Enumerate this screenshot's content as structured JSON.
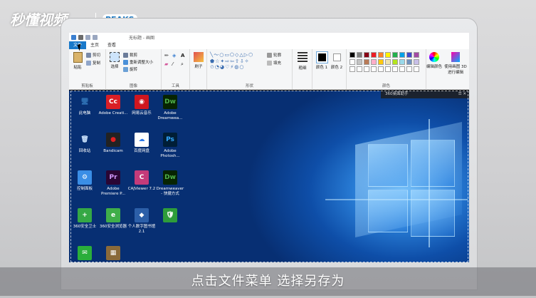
{
  "watermark": {
    "brand": "秒懂视频",
    "partner": "PEAKS"
  },
  "window": {
    "title": "无标题 - 画图"
  },
  "tabs": [
    "文件",
    "主页",
    "查看"
  ],
  "ribbon": {
    "clipboard": {
      "label": "剪贴板",
      "paste": "粘贴",
      "cut": "剪切",
      "copy": "复制"
    },
    "image": {
      "label": "图像",
      "select": "选择",
      "crop": "裁剪",
      "resize": "重新调整大小",
      "rotate": "旋转"
    },
    "tools": {
      "label": "工具"
    },
    "shapes": {
      "label": "形状",
      "brush": "刷子",
      "outline": "轮廓",
      "fill": "填充"
    },
    "size": {
      "label": "粗细"
    },
    "colors": {
      "label": "颜色",
      "color1": "颜色 1",
      "color2": "颜色 2",
      "edit": "编辑颜色",
      "paint3d": "使用画图 3D 进行编辑"
    }
  },
  "palette": [
    "#000000",
    "#7f7f7f",
    "#880015",
    "#ed1c24",
    "#ff7f27",
    "#fff200",
    "#22b14c",
    "#00a2e8",
    "#3f48cc",
    "#a349a4",
    "#ffffff",
    "#c3c3c3",
    "#b97a57",
    "#ffaec9",
    "#ffc90e",
    "#efe4b0",
    "#b5e61d",
    "#99d9ea",
    "#7092be",
    "#c8bfe7"
  ],
  "desktop": {
    "helper": {
      "title": "360桌面助手",
      "controls": "☰ ✕"
    },
    "icons": [
      {
        "name": "此电脑",
        "glyph": "🖥",
        "color": "#2b6cb0",
        "bg": "transparent"
      },
      {
        "name": "Adobe Creati...",
        "glyph": "Cc",
        "color": "#fff",
        "bg": "#da1f26"
      },
      {
        "name": "网易云音乐",
        "glyph": "◉",
        "color": "#fff",
        "bg": "#d0161f"
      },
      {
        "name": "Adobe Dreamwea...",
        "glyph": "Dw",
        "color": "#4fb14a",
        "bg": "#072401"
      },
      {
        "name": "回收站",
        "glyph": "🗑",
        "color": "#cfe6ff",
        "bg": "transparent"
      },
      {
        "name": "Bandicam",
        "glyph": "●",
        "color": "#e12020",
        "bg": "#222"
      },
      {
        "name": "百度网盘",
        "glyph": "☁",
        "color": "#2e7bea",
        "bg": "#fff"
      },
      {
        "name": "Adobe Photosh...",
        "glyph": "Ps",
        "color": "#31a8ff",
        "bg": "#001e36"
      },
      {
        "name": "控制面板",
        "glyph": "⚙",
        "color": "#fff",
        "bg": "#3a8ee6"
      },
      {
        "name": "Adobe Premiere P...",
        "glyph": "Pr",
        "color": "#d49bff",
        "bg": "#2a0634"
      },
      {
        "name": "CAJViewer 7.2",
        "glyph": "C",
        "color": "#fff",
        "bg": "#c43b7a"
      },
      {
        "name": "Dreamweaver - 快捷方式",
        "glyph": "Dw",
        "color": "#4fb14a",
        "bg": "#072401"
      },
      {
        "name": "360安全卫士",
        "glyph": "+",
        "color": "#fff",
        "bg": "#35a845"
      },
      {
        "name": "360安全浏览器",
        "glyph": "e",
        "color": "#fff",
        "bg": "#3fae49"
      },
      {
        "name": "个人数字图书馆2.1",
        "glyph": "◆",
        "color": "#fff",
        "bg": "#2c5fa8"
      },
      {
        "name": "",
        "glyph": "🛡",
        "color": "#fff",
        "bg": "#2e9d3a"
      },
      {
        "name": "",
        "glyph": "✉",
        "color": "#fff",
        "bg": "#2aae3a"
      },
      {
        "name": "",
        "glyph": "▦",
        "color": "#fff",
        "bg": "#8a6a3a"
      }
    ]
  },
  "caption": "点击文件菜单 选择另存为"
}
